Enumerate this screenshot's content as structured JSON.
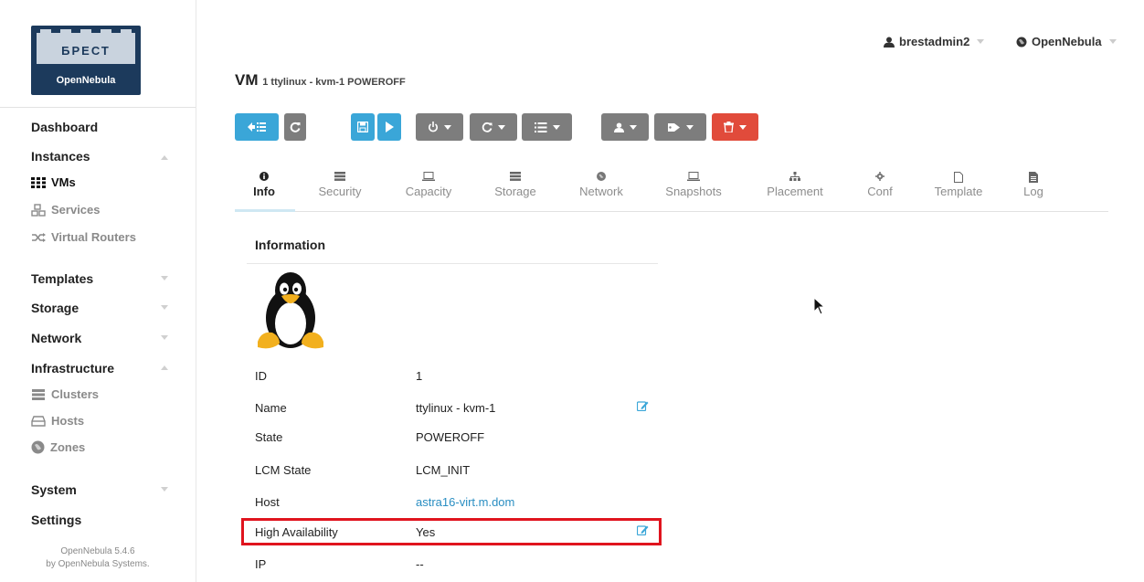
{
  "logo": {
    "title": "БРЕСТ",
    "subtitle": "OpenNebula"
  },
  "sidebar": {
    "dashboard": "Dashboard",
    "instances": "Instances",
    "vms": "VMs",
    "services": "Services",
    "virtual_routers": "Virtual Routers",
    "templates": "Templates",
    "storage": "Storage",
    "network": "Network",
    "infrastructure": "Infrastructure",
    "clusters": "Clusters",
    "hosts": "Hosts",
    "zones": "Zones",
    "system": "System",
    "settings": "Settings",
    "version": "OpenNebula 5.4.6",
    "by": "by OpenNebula Systems."
  },
  "header": {
    "user": "brestadmin2",
    "zone": "OpenNebula"
  },
  "page": {
    "title": "VM",
    "subtitle": "1 ttylinux - kvm-1 POWEROFF"
  },
  "tabs": {
    "info": "Info",
    "security": "Security",
    "capacity": "Capacity",
    "storage": "Storage",
    "network": "Network",
    "snapshots": "Snapshots",
    "placement": "Placement",
    "conf": "Conf",
    "template": "Template",
    "log": "Log"
  },
  "info": {
    "title": "Information",
    "rows": [
      {
        "label": "ID",
        "value": "1"
      },
      {
        "label": "Name",
        "value": "ttylinux - kvm-1"
      },
      {
        "label": "State",
        "value": "POWEROFF"
      },
      {
        "label": "LCM State",
        "value": "LCM_INIT"
      },
      {
        "label": "Host",
        "value": "astra16-virt.m.dom"
      },
      {
        "label": "High Availability",
        "value": "Yes"
      },
      {
        "label": "IP",
        "value": "--"
      }
    ]
  },
  "colors": {
    "accent": "#3aa6d8",
    "grey_button": "#7d7d7d",
    "danger": "#e14b3b",
    "highlight": "#e0141e"
  }
}
